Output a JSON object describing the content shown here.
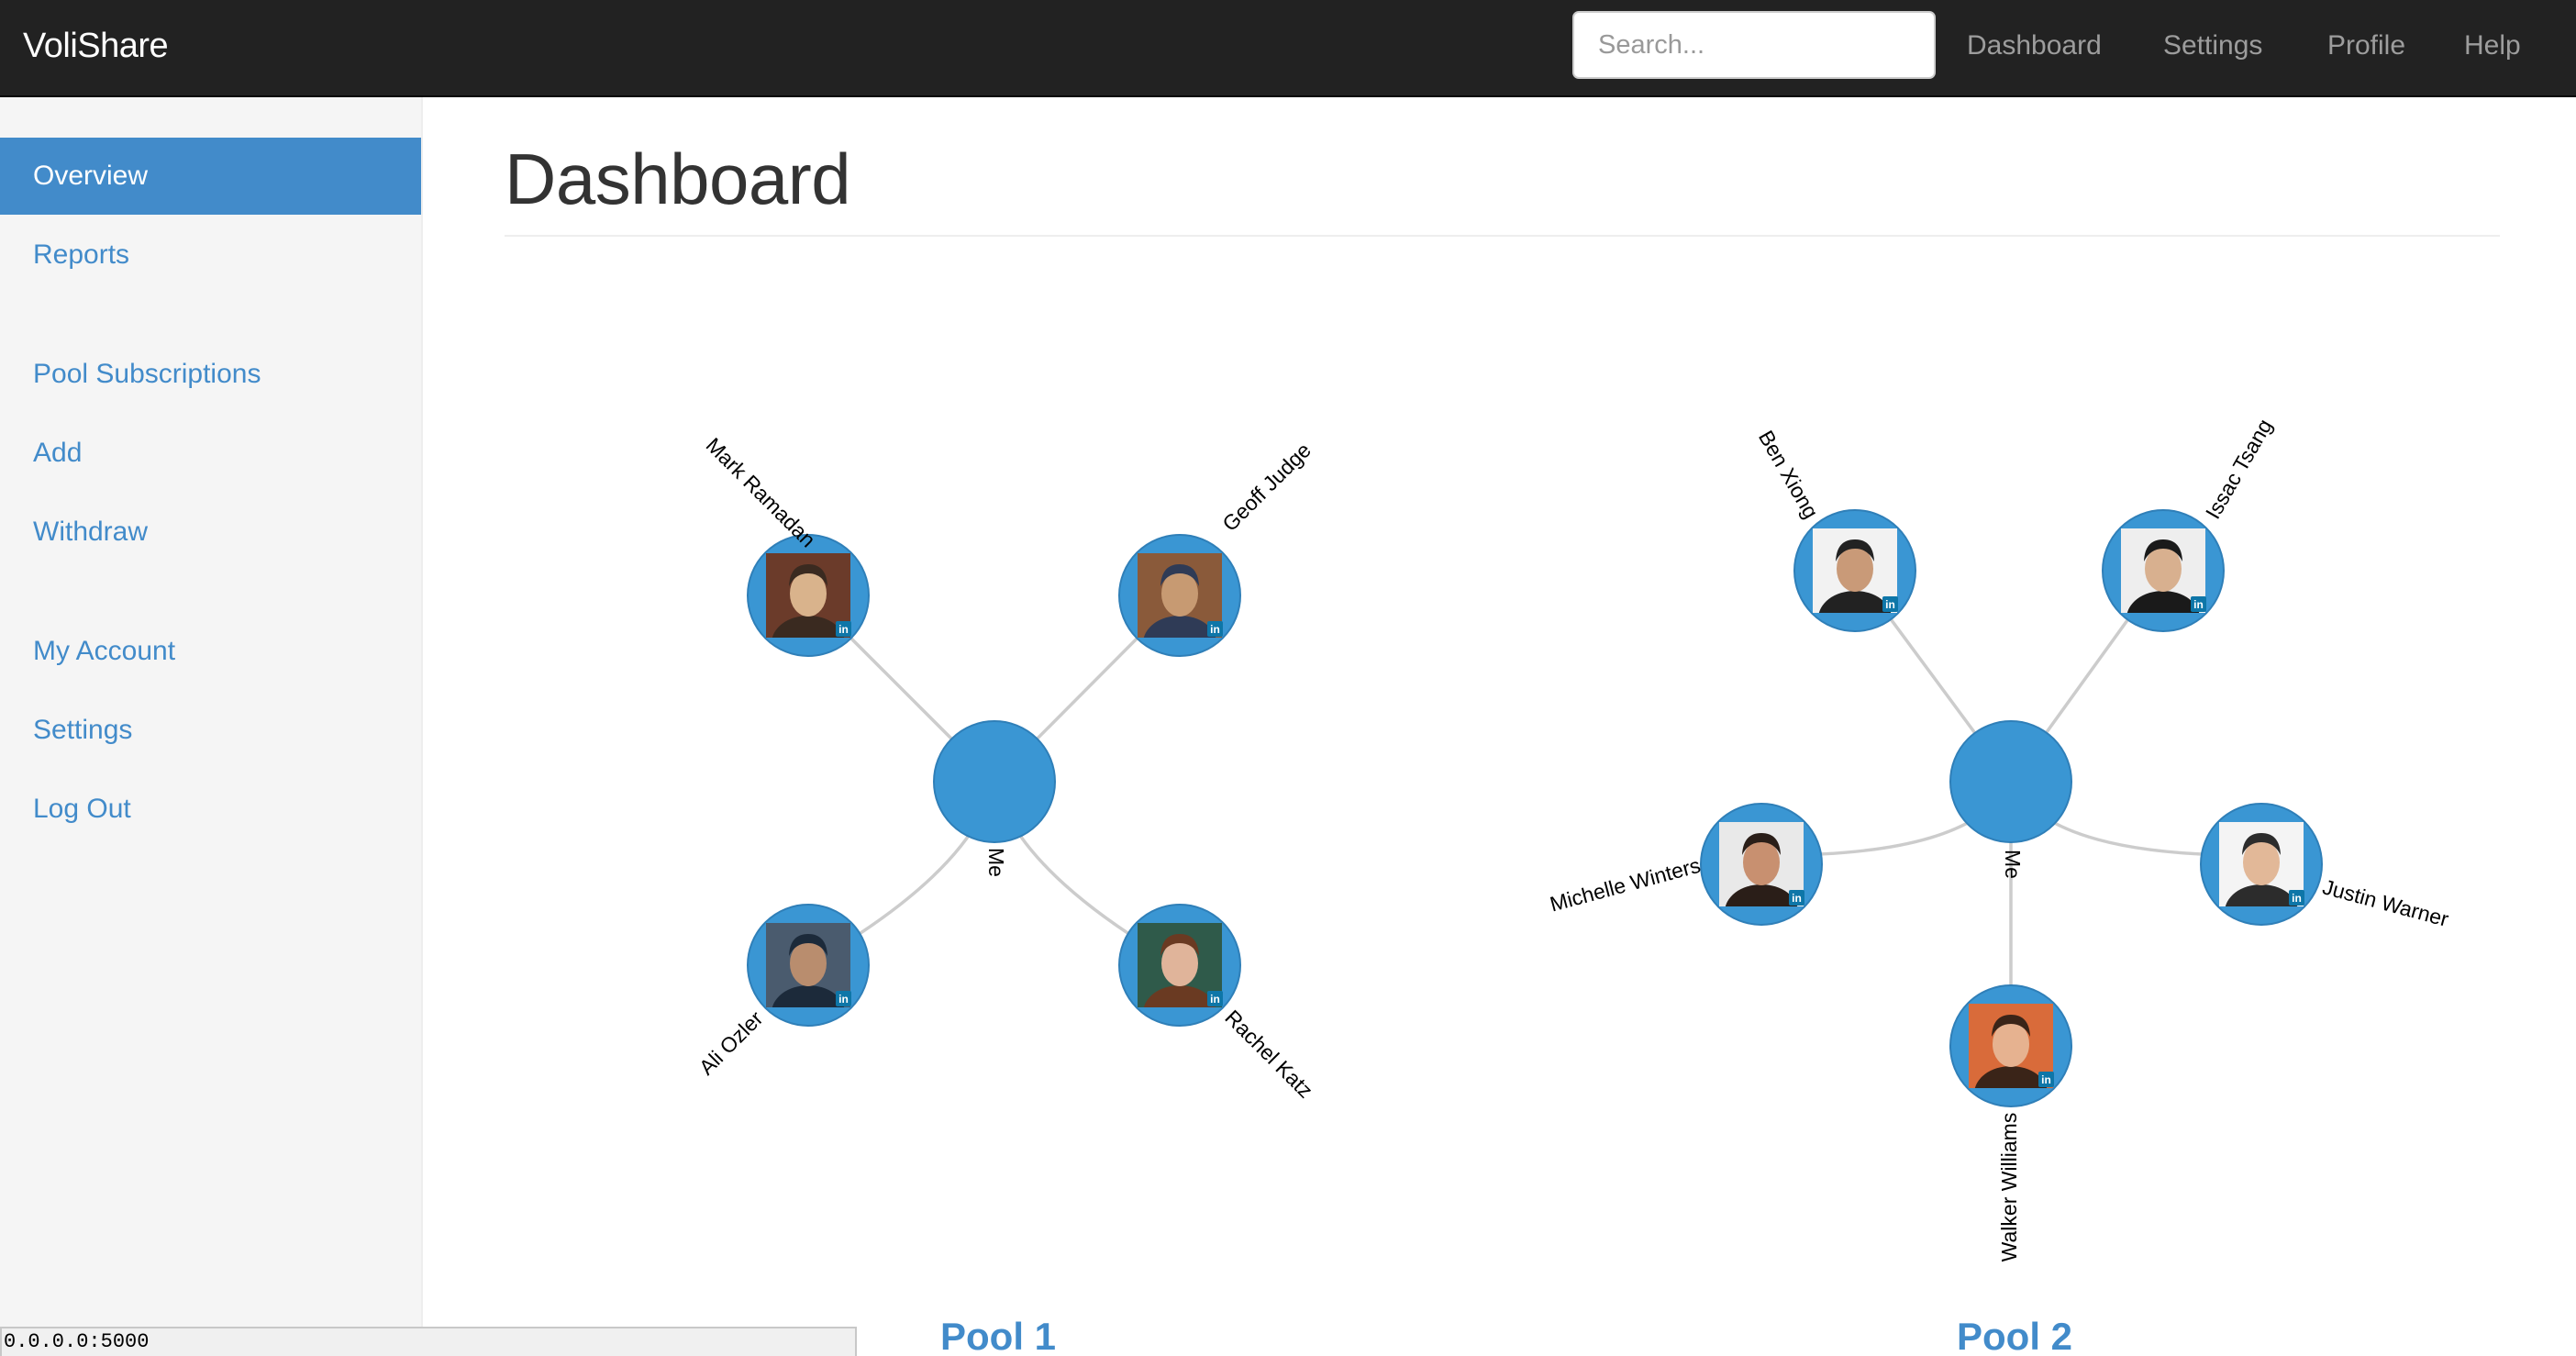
{
  "navbar": {
    "brand": "VoliShare",
    "search_placeholder": "Search...",
    "links": [
      "Dashboard",
      "Settings",
      "Profile",
      "Help"
    ]
  },
  "sidebar": {
    "items": [
      {
        "label": "Overview",
        "active": true
      },
      {
        "label": "Reports"
      },
      {
        "label": "Pool Subscriptions"
      },
      {
        "label": "Add"
      },
      {
        "label": "Withdraw"
      },
      {
        "label": "My Account"
      },
      {
        "label": "Settings"
      },
      {
        "label": "Log Out"
      }
    ]
  },
  "page_title": "Dashboard",
  "pools": [
    {
      "label": "Pool 1",
      "center_label": "Me",
      "members": [
        "Mark Ramadan",
        "Geoff Judge",
        "Ali Ozler",
        "Rachel Katz"
      ]
    },
    {
      "label": "Pool 2",
      "center_label": "Me",
      "members": [
        "Ben Xiong",
        "Issac Tsang",
        "Michelle Winters",
        "Justin Warner",
        "Walker Williams"
      ]
    }
  ],
  "status_bar": "0.0.0.0:5000",
  "colors": {
    "navbar": "#222222",
    "accent": "#428bca",
    "node": "#3a96d3",
    "sidebar": "#f5f5f5"
  },
  "icons": {
    "linkedin_badge": "linkedin-icon"
  }
}
